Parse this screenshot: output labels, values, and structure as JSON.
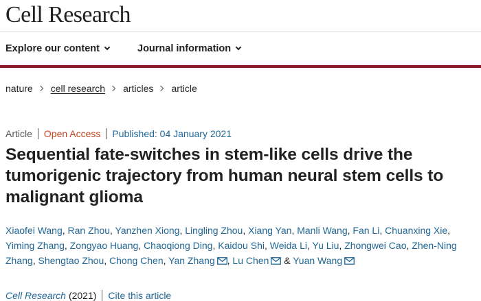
{
  "header": {
    "journal_name": "Cell Research"
  },
  "menu": {
    "explore": "Explore our content",
    "journal_info": "Journal information"
  },
  "breadcrumb": [
    "nature",
    "cell research",
    "articles",
    "article"
  ],
  "article": {
    "type": "Article",
    "open_access": "Open Access",
    "published": "Published: 04 January 2021",
    "title": "Sequential fate-switches in stem-like cells drive the tumorigenic trajectory from human neural stem cells to malignant glioma"
  },
  "authors": [
    "Xiaofei Wang",
    "Ran Zhou",
    "Yanzhen Xiong",
    "Lingling Zhou",
    "Xiang Yan",
    "Manli Wang",
    "Fan Li",
    "Chuanxing Xie",
    "Yiming Zhang",
    "Zongyao Huang",
    "Chaoqiong Ding",
    "Kaidou Shi",
    "Weida Li",
    "Yu Liu",
    "Zhongwei Cao",
    "Zhen-Ning Zhang",
    "Shengtao Zhou",
    "Chong Chen",
    "Yan Zhang",
    "Lu Chen",
    "Yuan Wang"
  ],
  "author_separators": {
    "comma": ", ",
    "last": " & "
  },
  "citation": {
    "journal": "Cell Research",
    "year": "(2021)",
    "cite_link": "Cite this article"
  },
  "colors": {
    "brand_bar": "#8a1a24",
    "link": "#1f6796",
    "open_access": "#c0461e"
  },
  "icons": {
    "menu_chevron": "chevron-down-icon",
    "breadcrumb_separator": "chevron-right-icon",
    "corresponding_author": "envelope-icon"
  }
}
